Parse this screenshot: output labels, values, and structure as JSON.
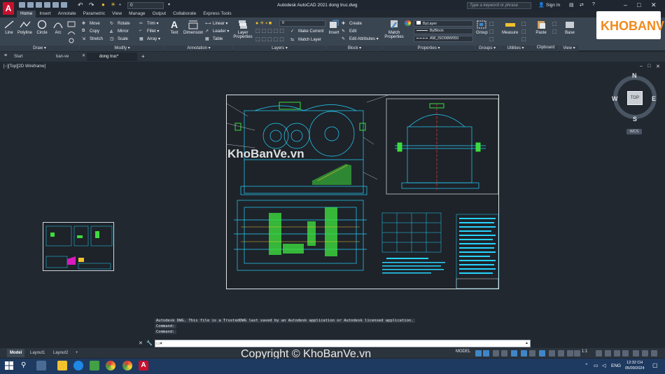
{
  "app": {
    "title": "Autodesk AutoCAD 2021    dong truc.dwg",
    "logo_letter": "A",
    "layer_combo": "0",
    "search_placeholder": "Type a keyword or phrase",
    "sign_in": "Sign In",
    "window_controls": [
      "–",
      "□",
      "✕"
    ]
  },
  "ribbon_tabs": [
    "Home",
    "Insert",
    "Annotate",
    "Parametric",
    "View",
    "Manage",
    "Output",
    "Collaborate",
    "Express Tools"
  ],
  "active_ribbon_tab": "Home",
  "ribbon": {
    "draw": {
      "title": "Draw ▾",
      "tools": [
        "Line",
        "Polyline",
        "Circle",
        "Arc"
      ]
    },
    "modify": {
      "title": "Modify ▾",
      "tools": [
        "Move",
        "Rotate",
        "Trim ▾",
        "Copy",
        "Mirror",
        "Fillet ▾",
        "Stretch",
        "Scale",
        "Array ▾"
      ]
    },
    "annotation": {
      "title": "Annotation ▾",
      "tools": [
        "Text",
        "Dimension",
        "Linear ▾",
        "Leader ▾",
        "Table"
      ]
    },
    "layers": {
      "title": "Layers ▾",
      "big": "Layer Properties",
      "combo": "0",
      "tools": [
        "Make Current",
        "Match Layer"
      ]
    },
    "insert": {
      "big": "Insert"
    },
    "block": {
      "title": "Block ▾",
      "tools": [
        "Create",
        "Edit",
        "Edit Attributes ▾"
      ]
    },
    "properties": {
      "title": "Properties ▾",
      "big": "Match Properties",
      "combos": [
        "ByLayer",
        "ByBlock",
        "AM_ISO08W050"
      ]
    },
    "groups": {
      "title": "Groups ▾",
      "big": "Group"
    },
    "utilities": {
      "title": "Utilities ▾",
      "big": "Measure"
    },
    "clipboard": {
      "title": "Clipboard",
      "big": "Paste"
    },
    "view": {
      "title": "View ▾",
      "big": "Base"
    }
  },
  "file_tabs": [
    "Start",
    "ban-ve",
    "dong truc*"
  ],
  "active_file_tab": "dong truc*",
  "viewport_label": "[−][Top][2D Wireframe]",
  "viewport_controls": [
    "–",
    "□",
    "✕"
  ],
  "viewcube": {
    "top": "TOP",
    "n": "N",
    "s": "S",
    "e": "E",
    "w": "W",
    "wcs": "WCS"
  },
  "watermarks": {
    "center": "KhoBanVe.vn",
    "footer": "Copyright © KhoBanVe.vn",
    "logo": "KHOBANVE"
  },
  "command": {
    "history": [
      "Autodesk DWG.  This file is a TrustedDWG last saved by an Autodesk application or Autodesk licensed application.",
      "Command:",
      "Command:"
    ],
    "input": ""
  },
  "layout_tabs": [
    "Model",
    "Layout1",
    "Layout2",
    "+"
  ],
  "active_layout_tab": "Model",
  "status": {
    "mode": "MODEL",
    "scale": "1:1"
  },
  "taskbar": {
    "lang": "ENG",
    "time": "12:32 CH",
    "date": "05/09/2024"
  },
  "colors": {
    "accent": "#3f86c8",
    "ribbon": "#3a4552",
    "canvas": "#212830",
    "drawing_cyan": "#27d3ff",
    "drawing_green": "#3ddc3d"
  }
}
